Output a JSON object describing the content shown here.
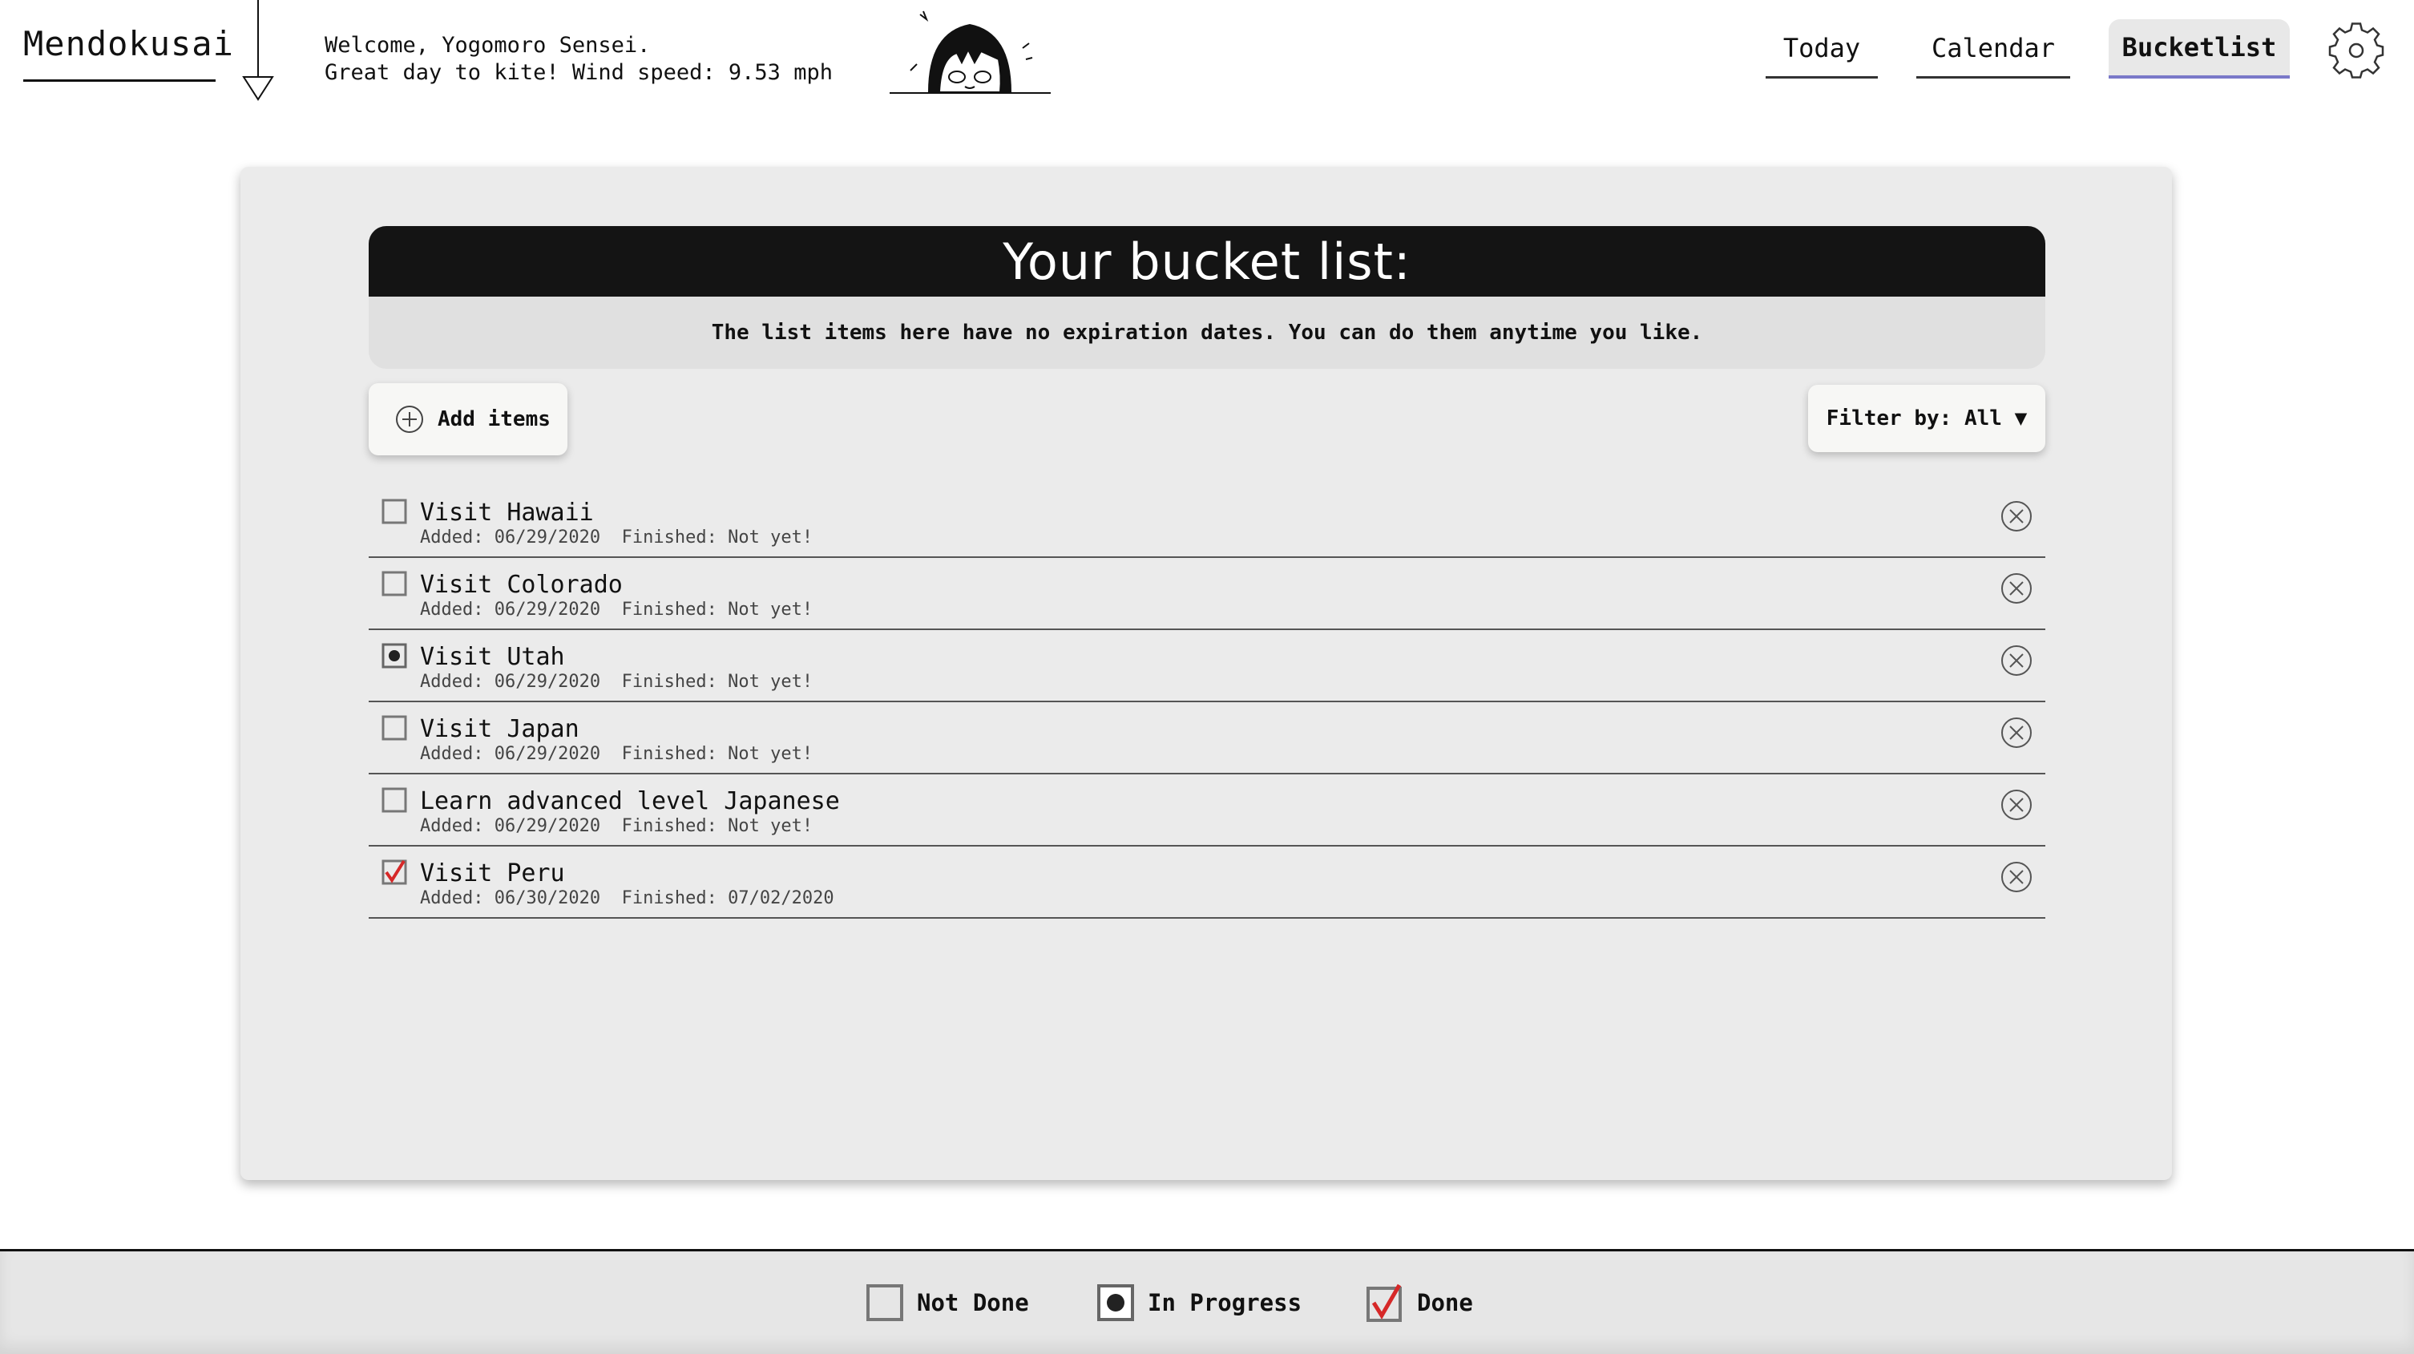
{
  "app": {
    "name": "Mendokusai"
  },
  "welcome": {
    "line1": "Welcome, Yogomoro Sensei.",
    "line2": "Great day to kite! Wind speed: 9.53 mph"
  },
  "nav": {
    "tabs": [
      {
        "label": "Today",
        "active": false
      },
      {
        "label": "Calendar",
        "active": false
      },
      {
        "label": "Bucketlist",
        "active": true
      }
    ]
  },
  "bucket": {
    "title": "Your bucket list:",
    "description": "The list items here have no expiration dates. You can do them anytime you like.",
    "add_label": "Add items",
    "filter_label": "Filter by: All ▼",
    "items": [
      {
        "title": "Visit Hawaii",
        "added": "Added: 06/29/2020",
        "finished": "Finished: Not yet!",
        "status": "not-done"
      },
      {
        "title": "Visit Colorado",
        "added": "Added: 06/29/2020",
        "finished": "Finished: Not yet!",
        "status": "not-done"
      },
      {
        "title": "Visit Utah",
        "added": "Added: 06/29/2020",
        "finished": "Finished: Not yet!",
        "status": "in-progress"
      },
      {
        "title": "Visit Japan",
        "added": "Added: 06/29/2020",
        "finished": "Finished: Not yet!",
        "status": "not-done"
      },
      {
        "title": "Learn advanced level Japanese",
        "added": "Added: 06/29/2020",
        "finished": "Finished: Not yet!",
        "status": "not-done"
      },
      {
        "title": "Visit Peru",
        "added": "Added: 06/30/2020",
        "finished": "Finished: 07/02/2020",
        "status": "done"
      }
    ]
  },
  "legend": {
    "not_done": "Not Done",
    "in_progress": "In Progress",
    "done": "Done"
  },
  "colors": {
    "accent": "#7a78c8",
    "check": "#d62828",
    "header_bar": "#141414"
  },
  "icons": [
    "arrow-down-icon",
    "mascot-icon",
    "gear-icon",
    "plus-circle-icon",
    "close-circle-icon",
    "checkbox-icon"
  ]
}
